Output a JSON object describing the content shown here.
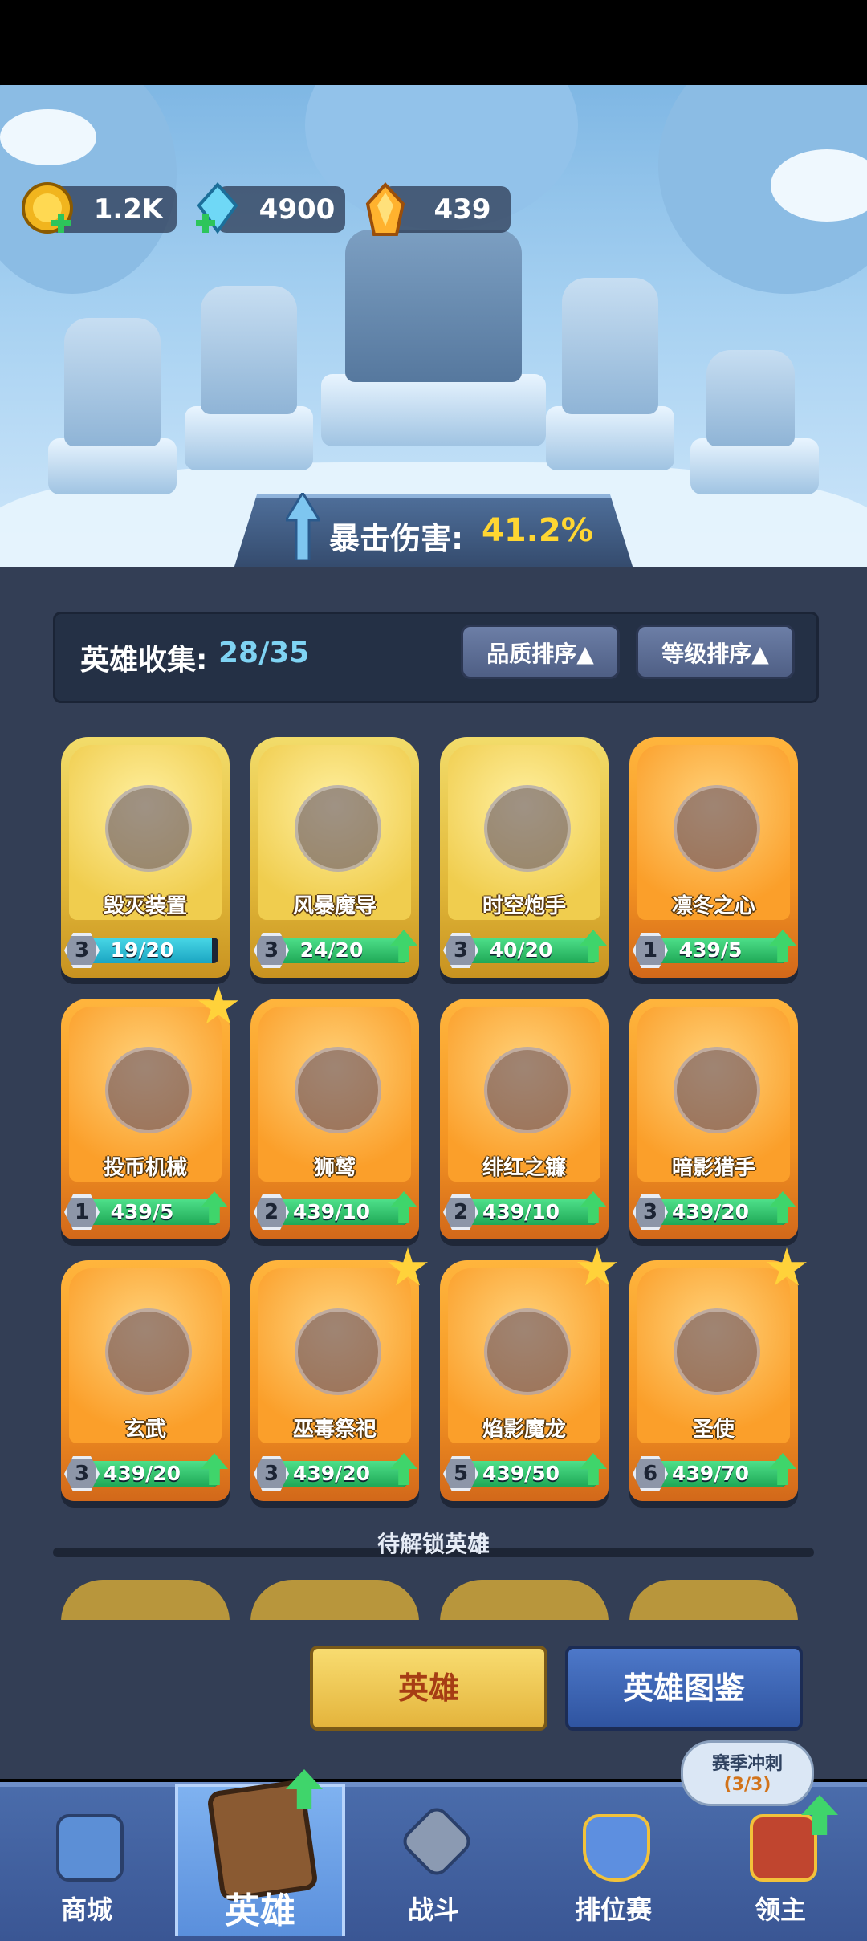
{
  "currencies": [
    {
      "name": "coin",
      "icon": "gold-coin-plus-icon",
      "value": "1.2K"
    },
    {
      "name": "crystal",
      "icon": "blue-crystal-plus-icon",
      "value": "4900"
    },
    {
      "name": "gem",
      "icon": "orange-crystal-icon",
      "value": "439"
    }
  ],
  "crit": {
    "label": "暴击伤害:",
    "value": "41.2%"
  },
  "collection": {
    "label": "英雄收集:",
    "count": "28/35"
  },
  "sort": {
    "quality": "品质排序▲",
    "level": "等级排序▲"
  },
  "heroes": [
    {
      "name": "毁灭装置",
      "level": "3",
      "progress": "19/20",
      "fill": 0.95,
      "rarity": "gold",
      "upgradable": false,
      "star": false,
      "icon": "cannon-device-icon"
    },
    {
      "name": "风暴魔导",
      "level": "3",
      "progress": "24/20",
      "fill": 1.0,
      "rarity": "gold",
      "upgradable": true,
      "star": false,
      "icon": "wizard-icon"
    },
    {
      "name": "时空炮手",
      "level": "3",
      "progress": "40/20",
      "fill": 1.0,
      "rarity": "gold",
      "upgradable": true,
      "star": false,
      "icon": "gunner-icon"
    },
    {
      "name": "凛冬之心",
      "level": "1",
      "progress": "439/5",
      "fill": 1.0,
      "rarity": "orange",
      "upgradable": true,
      "star": false,
      "icon": "ice-queen-icon"
    },
    {
      "name": "投币机械",
      "level": "1",
      "progress": "439/5",
      "fill": 1.0,
      "rarity": "orange",
      "upgradable": true,
      "star": true,
      "icon": "slot-machine-icon"
    },
    {
      "name": "狮鹫",
      "level": "2",
      "progress": "439/10",
      "fill": 1.0,
      "rarity": "orange",
      "upgradable": true,
      "star": false,
      "icon": "griffin-icon"
    },
    {
      "name": "绯红之镰",
      "level": "2",
      "progress": "439/10",
      "fill": 1.0,
      "rarity": "orange",
      "upgradable": true,
      "star": false,
      "icon": "scythe-demon-icon"
    },
    {
      "name": "暗影猎手",
      "level": "3",
      "progress": "439/20",
      "fill": 1.0,
      "rarity": "orange",
      "upgradable": true,
      "star": false,
      "icon": "shadow-hunter-icon"
    },
    {
      "name": "玄武",
      "level": "3",
      "progress": "439/20",
      "fill": 1.0,
      "rarity": "orange",
      "upgradable": true,
      "star": false,
      "icon": "turtle-serpent-icon"
    },
    {
      "name": "巫毒祭祀",
      "level": "3",
      "progress": "439/20",
      "fill": 1.0,
      "rarity": "orange",
      "upgradable": true,
      "star": true,
      "icon": "snake-priestess-icon"
    },
    {
      "name": "焰影魔龙",
      "level": "5",
      "progress": "439/50",
      "fill": 1.0,
      "rarity": "orange",
      "upgradable": true,
      "star": true,
      "icon": "black-dragon-icon"
    },
    {
      "name": "圣使",
      "level": "6",
      "progress": "439/70",
      "fill": 1.0,
      "rarity": "orange",
      "upgradable": true,
      "star": true,
      "icon": "angel-icon"
    }
  ],
  "locked_label": "待解锁英雄",
  "buttons": {
    "hero": "英雄",
    "codex": "英雄图鉴"
  },
  "season": {
    "line1": "赛季冲刺",
    "line2": "(3/3)"
  },
  "nav": [
    {
      "label": "商城",
      "icon": "shop-chest-icon"
    },
    {
      "label": "英雄",
      "icon": "hero-card-icon"
    },
    {
      "label": "战斗",
      "icon": "swords-icon"
    },
    {
      "label": "排位赛",
      "icon": "rank-shield-icon"
    },
    {
      "label": "领主",
      "icon": "castle-banner-icon"
    }
  ]
}
